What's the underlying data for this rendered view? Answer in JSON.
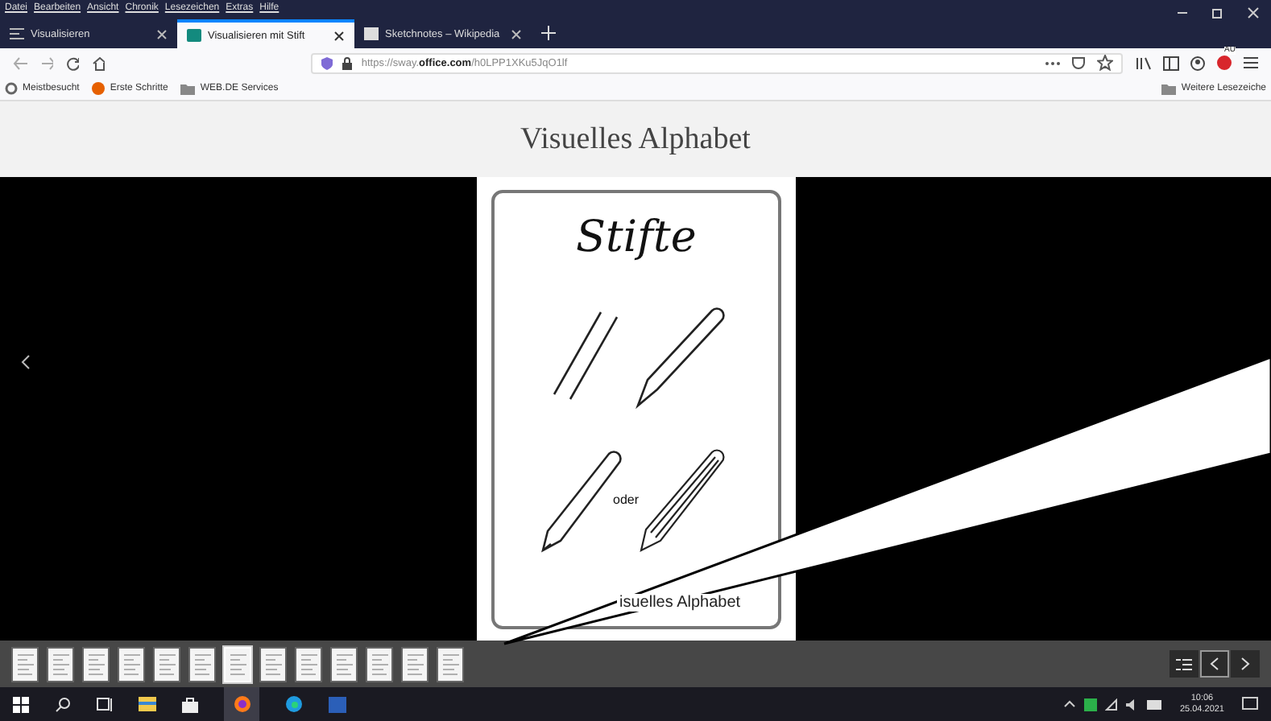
{
  "menu_bar": {
    "items": [
      "Datei",
      "Bearbeiten",
      "Ansicht",
      "Chronik",
      "Lesezeichen",
      "Extras",
      "Hilfe"
    ]
  },
  "tabs": [
    {
      "label": "Visualisieren",
      "selected": false,
      "kind": "list"
    },
    {
      "label": "Visualisieren mit Stift",
      "selected": true,
      "kind": "sway"
    },
    {
      "label": "Sketchnotes – Wikipedia",
      "selected": false,
      "kind": "wiki"
    }
  ],
  "address_bar": {
    "url_prefix": "https://sway.",
    "url_domain": "office.com",
    "url_path": "/h0LPP1XKu5JqO1lf"
  },
  "extension_badge": "AU",
  "bookmarks": [
    "Meistbesucht",
    "Erste Schritte",
    "WEB.DE Services"
  ],
  "other_bookmarks": "Weitere Lesezeiche",
  "page": {
    "title": "Visuelles Alphabet",
    "slide": {
      "heading": "Stifte",
      "word": "oder",
      "footer": "isuelles Alphabet"
    },
    "thumbnails": [
      {
        "selected": false
      },
      {
        "selected": false
      },
      {
        "selected": false
      },
      {
        "selected": false
      },
      {
        "selected": false
      },
      {
        "selected": false
      },
      {
        "selected": true
      },
      {
        "selected": false
      },
      {
        "selected": false
      },
      {
        "selected": false
      },
      {
        "selected": false
      },
      {
        "selected": false
      },
      {
        "selected": false
      }
    ]
  },
  "clock": {
    "time": "10:06",
    "date": "25.04.2021"
  }
}
